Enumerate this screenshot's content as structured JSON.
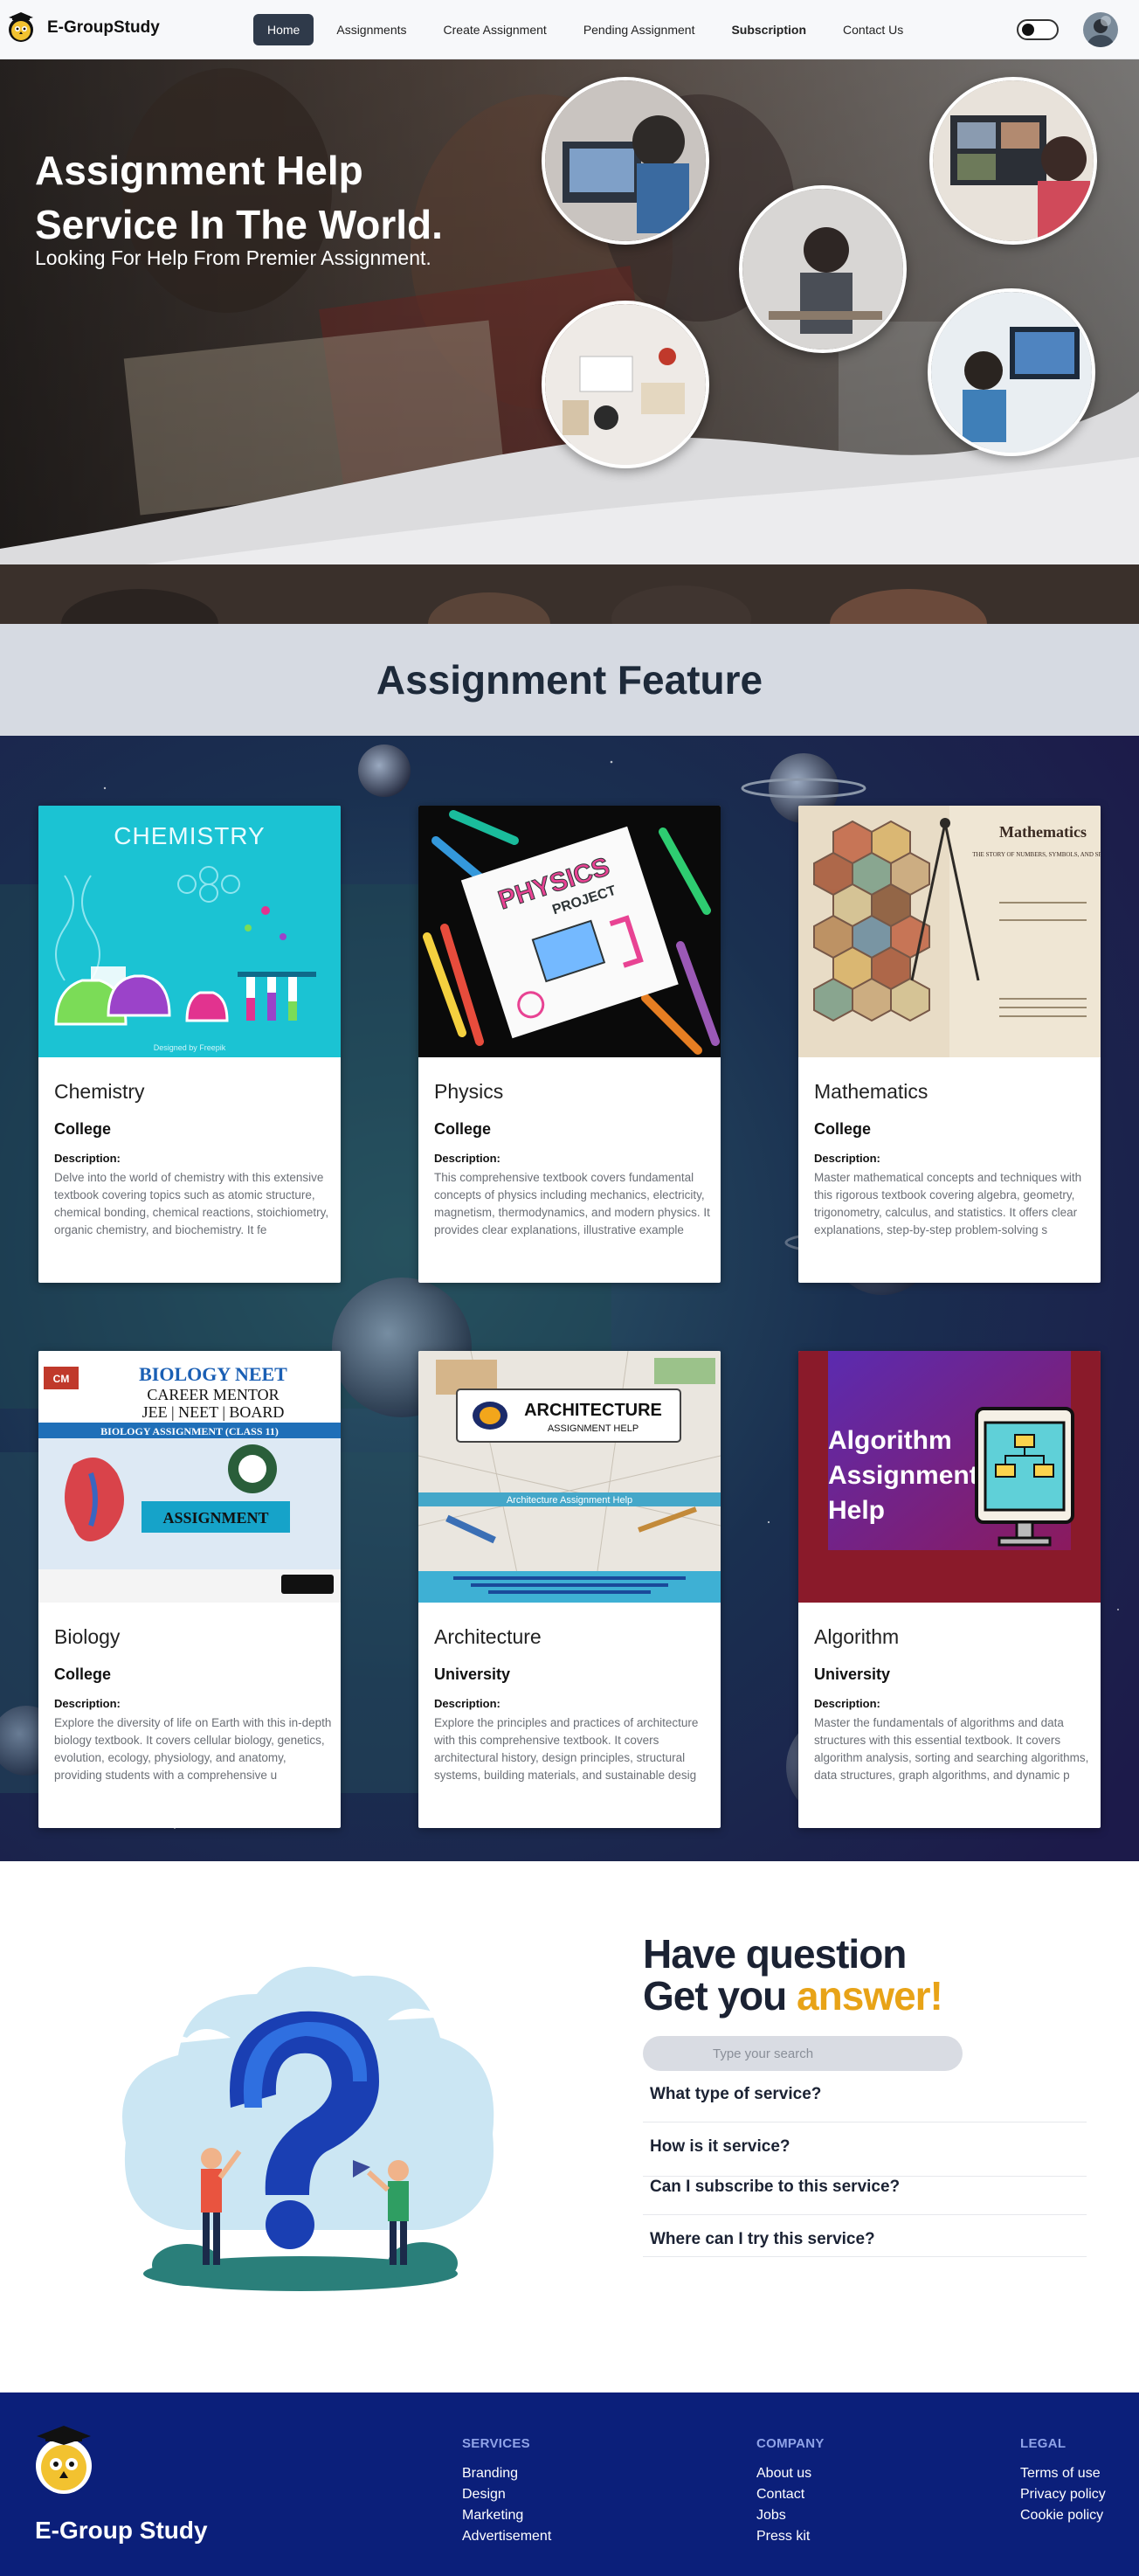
{
  "nav": {
    "brand": "E-GroupStudy",
    "items": [
      {
        "label": "Home"
      },
      {
        "label": "Assignments"
      },
      {
        "label": "Create Assignment"
      },
      {
        "label": "Pending Assignment"
      },
      {
        "label": "Subscription"
      },
      {
        "label": "Contact Us"
      }
    ],
    "active_index": 0
  },
  "hero": {
    "title_line1": "Assignment Help",
    "title_line2": "Service In The World.",
    "subtitle": "Looking For Help From Premier Assignment."
  },
  "features": {
    "heading": "Assignment Feature",
    "description_label": "Description:",
    "cards": [
      {
        "title": "Chemistry",
        "level": "College",
        "image_text": "CHEMISTRY",
        "image_footer": "Designed by Freepik",
        "desc": "Delve into the world of chemistry with this extensive textbook covering topics such as atomic structure, chemical bonding, chemical reactions, stoichiometry, organic chemistry, and biochemistry. It fe"
      },
      {
        "title": "Physics",
        "level": "College",
        "image_text": "PHYSICS",
        "image_sub": "PROJECT",
        "desc": "This comprehensive textbook covers fundamental concepts of physics including mechanics, electricity, magnetism, thermodynamics, and modern physics. It provides clear explanations, illustrative example"
      },
      {
        "title": "Mathematics",
        "level": "College",
        "image_text": "Mathematics",
        "image_sub": "THE STORY OF NUMBERS, SYMBOLS, AND SPACE",
        "desc": "Master mathematical concepts and techniques with this rigorous textbook covering algebra, geometry, trigonometry, calculus, and statistics. It offers clear explanations, step-by-step problem-solving s"
      },
      {
        "title": "Biology",
        "level": "College",
        "image_text": "BIOLOGY NEET",
        "image_sub": "CAREER MENTOR",
        "image_sub2": "JEE | NEET | BOARD",
        "image_sub3": "BIOLOGY ASSIGNMENT (CLASS 11)",
        "image_badge": "ASSIGNMENT",
        "desc": "Explore the diversity of life on Earth with this in-depth biology textbook. It covers cellular biology, genetics, evolution, ecology, physiology, and anatomy, providing students with a comprehensive u"
      },
      {
        "title": "Architecture",
        "level": "University",
        "image_text": "ARCHITECTURE",
        "image_sub": "ASSIGNMENT HELP",
        "image_band": "Architecture Assignment Help",
        "desc": "Explore the principles and practices of architecture with this comprehensive textbook. It covers architectural history, design principles, structural systems, building materials, and sustainable desig"
      },
      {
        "title": "Algorithm",
        "level": "University",
        "image_text": "Algorithm",
        "image_sub": "Assignment",
        "image_sub2": "Help",
        "desc": "Master the fundamentals of algorithms and data structures with this essential textbook. It covers algorithm analysis, sorting and searching algorithms, data structures, graph algorithms, and dynamic p"
      }
    ]
  },
  "faq": {
    "title_line1": "Have question",
    "title_line2_plain": "Get you",
    "title_line2_accent": "answer!",
    "search_placeholder": "Type your search",
    "questions": [
      "What type of service?",
      "How is it service?",
      "Can I subscribe to this service?",
      "Where can I try this service?"
    ]
  },
  "footer": {
    "brand": "E-Group Study",
    "services": {
      "heading": "SERVICES",
      "links": [
        "Branding",
        "Design",
        "Marketing",
        "Advertisement"
      ]
    },
    "company": {
      "heading": "COMPANY",
      "links": [
        "About us",
        "Contact",
        "Jobs",
        "Press kit"
      ]
    },
    "legal": {
      "heading": "LEGAL",
      "links": [
        "Terms of use",
        "Privacy policy",
        "Cookie policy"
      ]
    }
  },
  "colors": {
    "nav_active": "#2f3a4a",
    "accent_yellow": "#e8a317",
    "footer_bg": "#0b1f7a",
    "feature_heading_bg": "#d6dae2"
  }
}
